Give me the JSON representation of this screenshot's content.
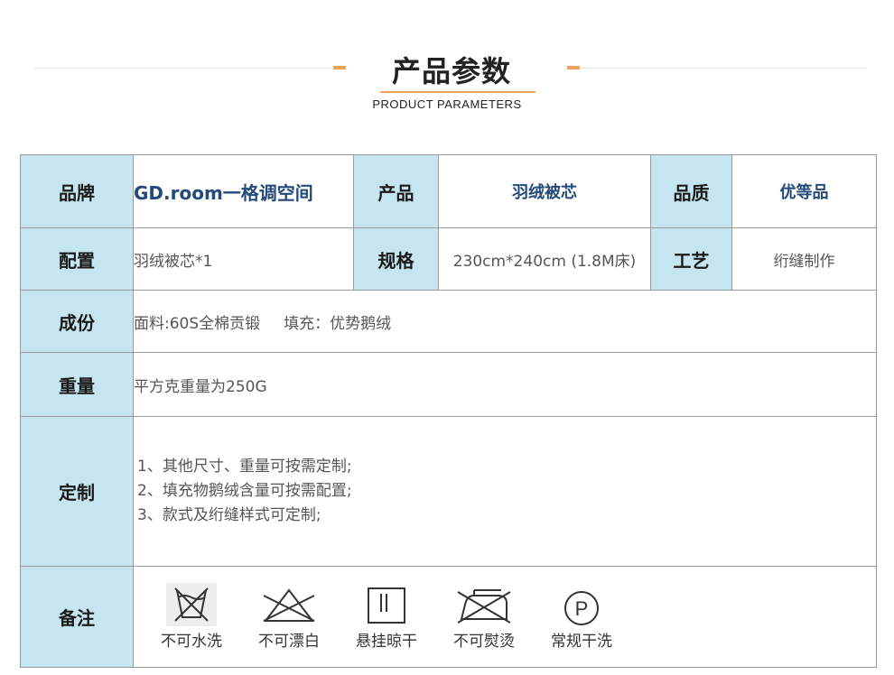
{
  "header": {
    "title": "产品参数",
    "subtitle": "PRODUCT PARAMETERS"
  },
  "rows": {
    "brand_label": "品牌",
    "brand_value": "GD.room一格调空间",
    "product_label": "产品",
    "product_value": "羽绒被芯",
    "quality_label": "品质",
    "quality_value": "优等品",
    "config_label": "配置",
    "config_value": "羽绒被芯*1",
    "spec_label": "规格",
    "spec_value": "230cm*240cm (1.8M床)",
    "craft_label": "工艺",
    "craft_value": "绗缝制作",
    "composition_label": "成份",
    "composition_fabric": "面料:60S全棉贡锻",
    "composition_fill": "填充：优势鹅绒",
    "weight_label": "重量",
    "weight_value": "平方克重量为250G",
    "custom_label": "定制",
    "custom_items": [
      "1、其他尺寸、重量可按需定制;",
      "2、填充物鹅绒含量可按需配置;",
      "3、款式及绗缝样式可定制;"
    ],
    "care_label": "备注"
  },
  "care_icons": [
    {
      "icon": "no-wash-icon",
      "label": "不可水洗"
    },
    {
      "icon": "no-bleach-icon",
      "label": "不可漂白"
    },
    {
      "icon": "hang-dry-icon",
      "label": "悬挂晾干"
    },
    {
      "icon": "no-iron-icon",
      "label": "不可熨烫"
    },
    {
      "icon": "dry-clean-p-icon",
      "label": "常规干洗"
    }
  ],
  "colors": {
    "label_bg": "#c5e5f0",
    "accent": "#f0a15a",
    "brand_text": "#234a7a"
  }
}
